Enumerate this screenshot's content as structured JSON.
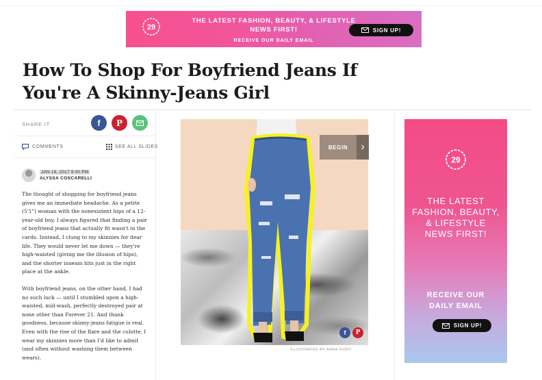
{
  "banner": {
    "line1": "THE LATEST FASHION, BEAUTY, & LIFESTYLE",
    "line2": "NEWS FIRST!",
    "line3": "RECEIVE OUR DAILY EMAIL",
    "signup_label": "SIGN UP!",
    "logo_text": "29"
  },
  "article": {
    "title": "How To Shop For Boyfriend Jeans If You're A Skinny-Jeans Girl",
    "share_label": "SHARE IT",
    "comments_label": "COMMENTS",
    "slides_label": "SEE ALL SLIDES",
    "date": "JAN 16, 2017 9:00 PM",
    "author": "ALYSSA COSCARELLI",
    "paragraphs": [
      "The thought of shopping for boyfriend jeans gives me an immediate headache. As a petite (5'1\") woman with the nonexistent hips of a 12-year-old boy, I always figured that finding a pair of boyfriend jeans that actually fit wasn't in the cards. Instead, I clung to my skinnies for dear life. They would never let me down — they're high-waisted (giving me the illusion of hips), and the shorter inseam hits just in the right place at the ankle.",
      "With boyfriend jeans, on the other hand, I had no such luck — until I stumbled upon a high-waisted, mid-wash, perfectly destroyed pair at none other than Forever 21. And thank goodness, because skinny-jeans fatigue is real. Even with the rise of the flare and the culotte, I wear my skinnies more than I'd like to admit (and often without washing them between wears)."
    ]
  },
  "slideshow": {
    "begin_label": "BEGIN",
    "credit": "ILLUSTRATED BY ANNA SUDIT."
  },
  "side_ad": {
    "logo_text": "29",
    "headline": [
      "THE LATEST",
      "FASHION, BEAUTY,",
      "& LIFESTYLE",
      "NEWS FIRST!"
    ],
    "receive": [
      "RECEIVE OUR",
      "DAILY EMAIL"
    ],
    "signup_label": "SIGN UP!"
  },
  "colors": {
    "facebook": "#3a5595",
    "pinterest": "#cc2030",
    "email": "#58c47c",
    "brand_pink": "#f44b86"
  }
}
